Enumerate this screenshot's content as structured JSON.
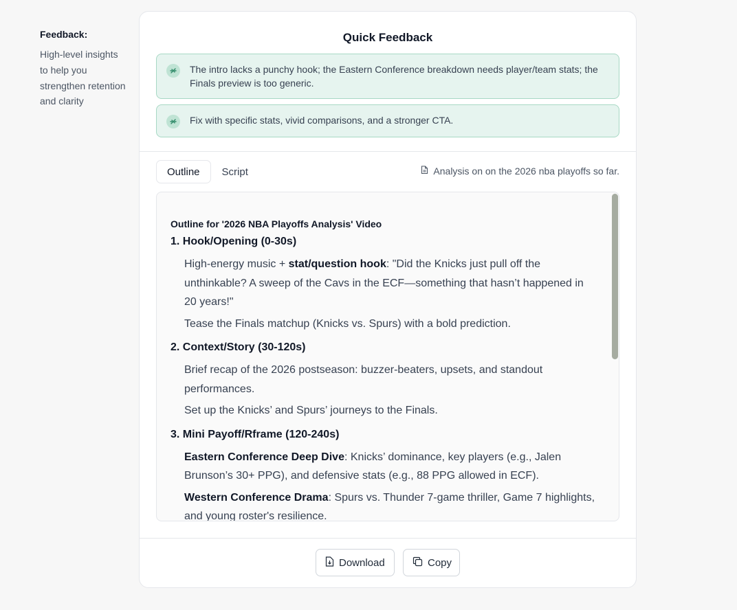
{
  "sidebar": {
    "title": "Feedback:",
    "description": "High-level insights to help you strengthen retention and clarity"
  },
  "card": {
    "title": "Quick Feedback",
    "feedback_items": [
      "The intro lacks a punchy hook; the Eastern Conference breakdown needs player/team stats; the Finals preview is too generic.",
      "Fix with specific stats, vivid comparisons, and a stronger CTA."
    ],
    "tabs": [
      "Outline",
      "Script"
    ],
    "active_tab": "Outline",
    "doc_label": "Analysis on on the 2026 nba playoffs so far."
  },
  "outline": {
    "title": "Outline for '2026 NBA Playoffs Analysis' Video",
    "sections": [
      {
        "heading": "1. Hook/Opening (0-30s)",
        "p1_pre": "High-energy music + ",
        "p1_bold": "stat/question hook",
        "p1_post": ": \"Did the Knicks just pull off the unthinkable? A sweep of the Cavs in the ECF—something that hasn’t happened in 20 years!\"",
        "p2": "Tease the Finals matchup (Knicks vs. Spurs) with a bold prediction."
      },
      {
        "heading": "2. Context/Story (30-120s)",
        "p1": "Brief recap of the 2026 postseason: buzzer-beaters, upsets, and standout performances.",
        "p2": "Set up the Knicks’ and Spurs’ journeys to the Finals."
      },
      {
        "heading": "3. Mini Payoff/Rframe (120-240s)",
        "p1_bold": "Eastern Conference Deep Dive",
        "p1_post": ": Knicks’ dominance, key players (e.g., Jalen Brunson’s 30+ PPG), and defensive stats (e.g., 88 PPG allowed in ECF).",
        "p2_bold": "Western Conference Drama",
        "p2_post": ": Spurs vs. Thunder 7-game thriller, Game 7 highlights, and young roster's resilience."
      }
    ]
  },
  "footer": {
    "download_label": "Download",
    "copy_label": "Copy"
  },
  "colors": {
    "feedback_bg": "#e6f4ef",
    "feedback_border": "#a7d8c4",
    "scroll_thumb": "#a6aca1"
  },
  "icons": {
    "feedback": "sparkle-icon",
    "doc": "document-icon",
    "download": "download-file-icon",
    "copy": "copy-icon"
  }
}
